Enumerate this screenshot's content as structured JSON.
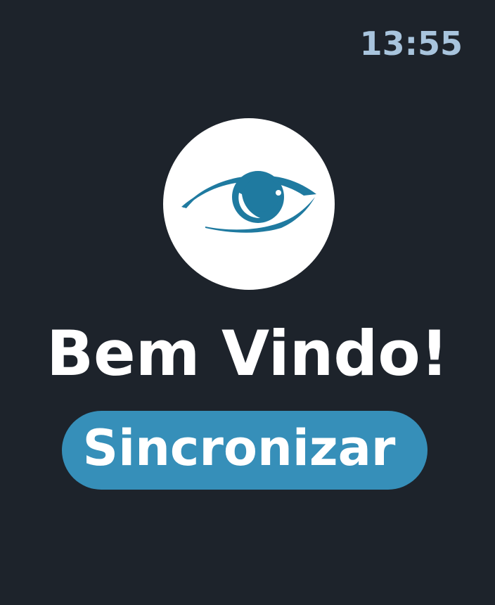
{
  "status_bar": {
    "time": "13:55"
  },
  "logo": {
    "icon": "eye-icon",
    "circle_color": "#ffffff",
    "eye_color": "#1f7aa0"
  },
  "main": {
    "welcome_text": "Bem Vindo!"
  },
  "actions": {
    "sync_label": "Sincronizar",
    "sync_color": "#368fb9"
  },
  "colors": {
    "background": "#1d232b",
    "clock": "#a8c4dd",
    "text": "#ffffff"
  }
}
